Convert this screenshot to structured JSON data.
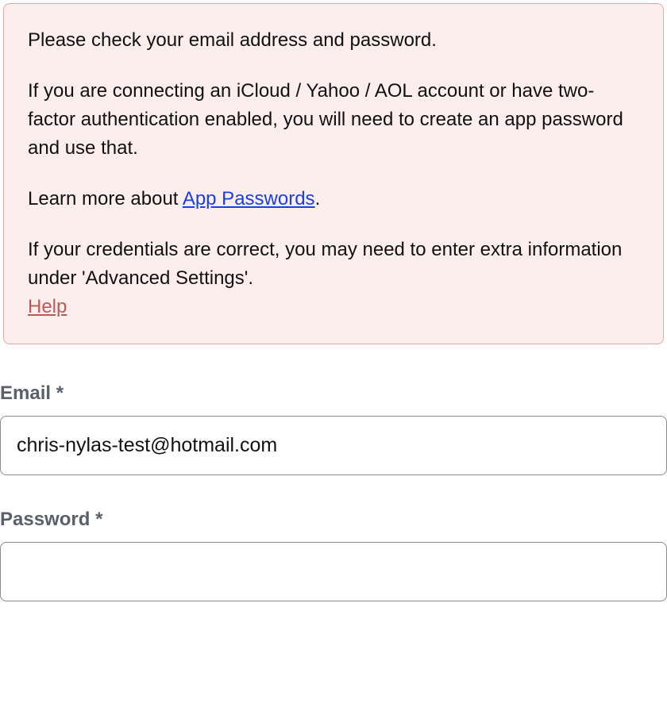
{
  "error": {
    "p1": "Please check your email address and password.",
    "p2": "If you are connecting an iCloud / Yahoo / AOL account or have two-factor authentication enabled, you will need to create an app password and use that.",
    "p3_prefix": "Learn more about ",
    "p3_link": "App Passwords",
    "p3_suffix": ".",
    "p4": "If your credentials are correct, you may need to enter extra information under 'Advanced Settings'.",
    "help_link": "Help"
  },
  "form": {
    "email_label": "Email",
    "email_asterisk": "*",
    "email_value": "chris-nylas-test@hotmail.com",
    "password_label": "Password",
    "password_asterisk": "*",
    "password_value": ""
  }
}
